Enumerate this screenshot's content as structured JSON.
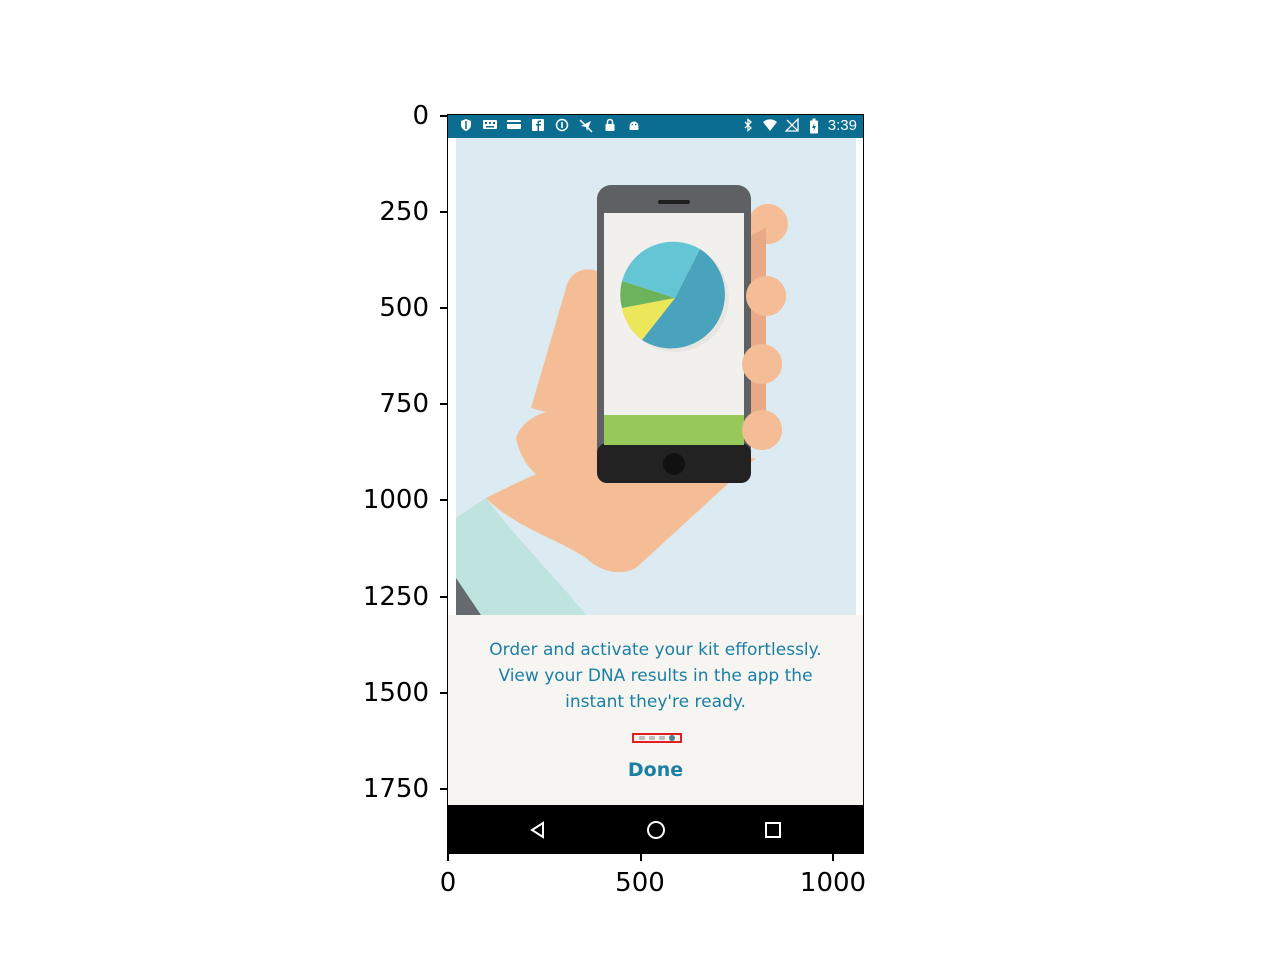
{
  "axes": {
    "y_ticks": [
      "0",
      "250",
      "500",
      "750",
      "1000",
      "1250",
      "1500",
      "1750"
    ],
    "x_ticks": [
      "0",
      "500",
      "1000"
    ]
  },
  "status_bar": {
    "background": "#0b6e91",
    "left_icons": [
      "shield-icon",
      "keyboard-icon",
      "card-icon",
      "facebook-icon",
      "info-icon",
      "no-location-icon",
      "lock-icon",
      "android-icon"
    ],
    "right_icons": [
      "bluetooth-icon",
      "wifi-icon",
      "no-signal-icon",
      "battery-icon"
    ],
    "time": "3:39"
  },
  "onboarding": {
    "description_lines": [
      "Order and activate your kit effortlessly.",
      "View your DNA results in the app the",
      "instant they're ready."
    ],
    "page_indicator": {
      "count": 4,
      "active_index": 3
    },
    "done_label": "Done",
    "accent_color": "#1a7fa3"
  },
  "nav_bar": {
    "buttons": [
      "back-icon",
      "home-icon",
      "recents-icon"
    ]
  }
}
